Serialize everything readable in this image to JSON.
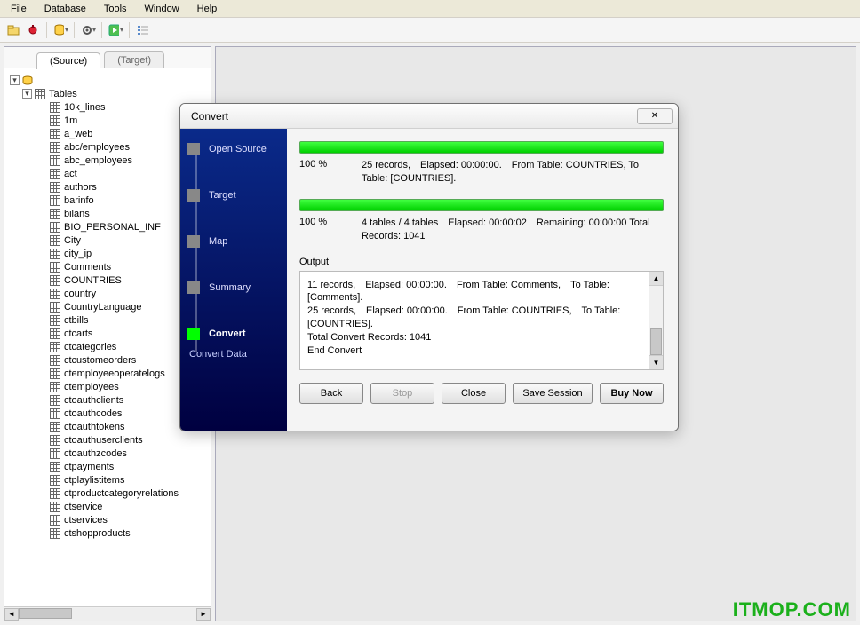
{
  "menu": [
    "File",
    "Database",
    "Tools",
    "Window",
    "Help"
  ],
  "tabs": {
    "source": "(Source)",
    "target": "(Target)"
  },
  "tree": {
    "root_label": "Tables",
    "items": [
      "10k_lines",
      "1m",
      "a_web",
      "abc/employees",
      "abc_employees",
      "act",
      "authors",
      "barinfo",
      "bilans",
      "BIO_PERSONAL_INF",
      "City",
      "city_ip",
      "Comments",
      "COUNTRIES",
      "country",
      "CountryLanguage",
      "ctbills",
      "ctcarts",
      "ctcategories",
      "ctcustomeorders",
      "ctemployeeoperatelogs",
      "ctemployees",
      "ctoauthclients",
      "ctoauthcodes",
      "ctoauthtokens",
      "ctoauthuserclients",
      "ctoauthzcodes",
      "ctpayments",
      "ctplaylistitems",
      "ctproductcategoryrelations",
      "ctservice",
      "ctservices",
      "ctshopproducts"
    ]
  },
  "dialog": {
    "title": "Convert",
    "close_glyph": "✕",
    "wizard_steps": [
      "Open Source",
      "Target",
      "Map",
      "Summary",
      "Convert"
    ],
    "wizard_active_index": 4,
    "wizard_footer": "Convert Data",
    "progress1_pct": "100 %",
    "progress1_text": "25 records, Elapsed: 00:00:00. From Table: COUNTRIES, To Table: [COUNTRIES].",
    "progress2_pct": "100 %",
    "progress2_text": "4 tables / 4 tables Elapsed: 00:00:02 Remaining: 00:00:00 Total Records: 1041",
    "output_label": "Output",
    "output_lines": [
      "11 records, Elapsed: 00:00:00. From Table: Comments, To Table: [Comments].",
      "25 records, Elapsed: 00:00:00. From Table: COUNTRIES, To Table: [COUNTRIES].",
      "Total Convert Records: 1041",
      "End Convert"
    ],
    "buttons": {
      "back": "Back",
      "stop": "Stop",
      "close": "Close",
      "save": "Save Session",
      "buy": "Buy Now"
    }
  },
  "watermark": "ITMOP.COM"
}
